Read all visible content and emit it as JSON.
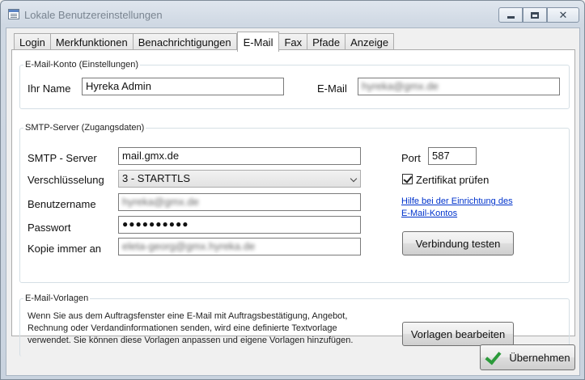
{
  "window": {
    "title": "Lokale Benutzereinstellungen",
    "min_glyph": "_",
    "max_glyph": "□",
    "close_glyph": "✕"
  },
  "tabs": [
    {
      "label": "Login"
    },
    {
      "label": "Merkfunktionen"
    },
    {
      "label": "Benachrichtigungen"
    },
    {
      "label": "E-Mail",
      "active": true
    },
    {
      "label": "Fax"
    },
    {
      "label": "Pfade"
    },
    {
      "label": "Anzeige"
    }
  ],
  "account": {
    "legend": "E-Mail-Konto (Einstellungen)",
    "name_label": "Ihr Name",
    "name_value": "Hyreka Admin",
    "email_label": "E-Mail",
    "email_value": "hyreka@gmx.de"
  },
  "smtp": {
    "legend": "SMTP-Server (Zugangsdaten)",
    "server_label": "SMTP - Server",
    "server_value": "mail.gmx.de",
    "encryption_label": "Verschlüsselung",
    "encryption_value": "3 - STARTTLS",
    "username_label": "Benutzername",
    "username_value": "hyreka@gmx.de",
    "password_label": "Passwort",
    "password_value": "●●●●●●●●●●",
    "copy_label": "Kopie immer an",
    "copy_value": "eleta-georg@gmx.hyreka.de",
    "port_label": "Port",
    "port_value": "587",
    "cert_label": "Zertifikat prüfen",
    "cert_checked": true,
    "help_line1": "Hilfe bei der Einrichtung des",
    "help_line2": "E-Mail-Kontos",
    "test_button": "Verbindung testen"
  },
  "templates": {
    "legend": "E-Mail-Vorlagen",
    "desc_line1": "Wenn Sie aus dem Auftragsfenster eine E-Mail mit Auftragsbestätigung, Angebot,",
    "desc_line2": "Rechnung oder Verdandinformationen senden, wird eine definierte Textvorlage",
    "desc_line3": "verwendet. Sie können diese Vorlagen anpassen und eigene Vorlagen hinzufügen.",
    "edit_button": "Vorlagen bearbeiten"
  },
  "footer": {
    "apply_button": "Übernehmen",
    "apply_icon": "checkmark-icon",
    "icon_color": "#2b9a3a"
  }
}
